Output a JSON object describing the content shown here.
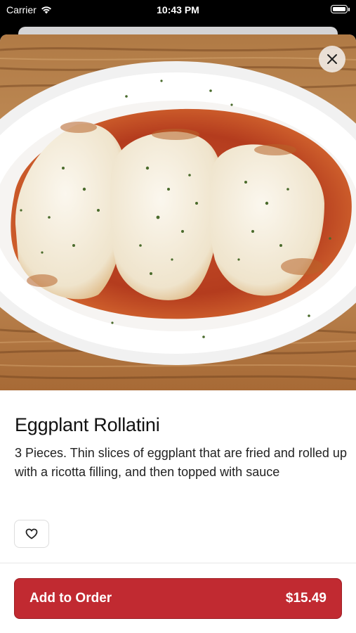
{
  "status_bar": {
    "carrier": "Carrier",
    "time": "10:43 PM",
    "icons": [
      "wifi-icon",
      "battery-icon"
    ]
  },
  "item": {
    "image": "eggplant-rollatini-photo",
    "name": "Eggplant Rollatini",
    "description": "3 Pieces. Thin slices of eggplant that are fried and rolled up with a ricotta filling, and then topped with sauce"
  },
  "actions": {
    "close_icon": "close-icon",
    "favorite_icon": "heart-icon",
    "add_to_order_label": "Add to Order",
    "price": "$15.49"
  },
  "colors": {
    "accent": "#c12a31",
    "background": "#ffffff",
    "text": "#111111"
  }
}
